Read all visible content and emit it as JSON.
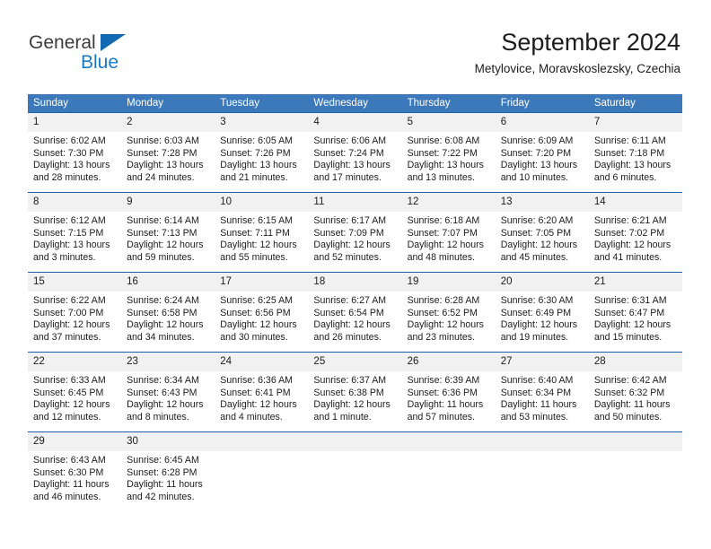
{
  "brand": {
    "name_top": "General",
    "name_bottom": "Blue",
    "triangle_color": "#1268b3",
    "top_color": "#3c3c3c",
    "bottom_color": "#1a7ac4"
  },
  "header": {
    "title": "September 2024",
    "subtitle": "Metylovice, Moravskoslezsky, Czechia"
  },
  "theme": {
    "header_bg": "#3b79ba",
    "week_border": "#1c5ea8",
    "daynum_bg": "#f1f1f1",
    "text": "#1c1c1c"
  },
  "weekdays": [
    "Sunday",
    "Monday",
    "Tuesday",
    "Wednesday",
    "Thursday",
    "Friday",
    "Saturday"
  ],
  "weeks": [
    [
      {
        "day": "1",
        "sunrise": "Sunrise: 6:02 AM",
        "sunset": "Sunset: 7:30 PM",
        "daylight1": "Daylight: 13 hours",
        "daylight2": "and 28 minutes."
      },
      {
        "day": "2",
        "sunrise": "Sunrise: 6:03 AM",
        "sunset": "Sunset: 7:28 PM",
        "daylight1": "Daylight: 13 hours",
        "daylight2": "and 24 minutes."
      },
      {
        "day": "3",
        "sunrise": "Sunrise: 6:05 AM",
        "sunset": "Sunset: 7:26 PM",
        "daylight1": "Daylight: 13 hours",
        "daylight2": "and 21 minutes."
      },
      {
        "day": "4",
        "sunrise": "Sunrise: 6:06 AM",
        "sunset": "Sunset: 7:24 PM",
        "daylight1": "Daylight: 13 hours",
        "daylight2": "and 17 minutes."
      },
      {
        "day": "5",
        "sunrise": "Sunrise: 6:08 AM",
        "sunset": "Sunset: 7:22 PM",
        "daylight1": "Daylight: 13 hours",
        "daylight2": "and 13 minutes."
      },
      {
        "day": "6",
        "sunrise": "Sunrise: 6:09 AM",
        "sunset": "Sunset: 7:20 PM",
        "daylight1": "Daylight: 13 hours",
        "daylight2": "and 10 minutes."
      },
      {
        "day": "7",
        "sunrise": "Sunrise: 6:11 AM",
        "sunset": "Sunset: 7:18 PM",
        "daylight1": "Daylight: 13 hours",
        "daylight2": "and 6 minutes."
      }
    ],
    [
      {
        "day": "8",
        "sunrise": "Sunrise: 6:12 AM",
        "sunset": "Sunset: 7:15 PM",
        "daylight1": "Daylight: 13 hours",
        "daylight2": "and 3 minutes."
      },
      {
        "day": "9",
        "sunrise": "Sunrise: 6:14 AM",
        "sunset": "Sunset: 7:13 PM",
        "daylight1": "Daylight: 12 hours",
        "daylight2": "and 59 minutes."
      },
      {
        "day": "10",
        "sunrise": "Sunrise: 6:15 AM",
        "sunset": "Sunset: 7:11 PM",
        "daylight1": "Daylight: 12 hours",
        "daylight2": "and 55 minutes."
      },
      {
        "day": "11",
        "sunrise": "Sunrise: 6:17 AM",
        "sunset": "Sunset: 7:09 PM",
        "daylight1": "Daylight: 12 hours",
        "daylight2": "and 52 minutes."
      },
      {
        "day": "12",
        "sunrise": "Sunrise: 6:18 AM",
        "sunset": "Sunset: 7:07 PM",
        "daylight1": "Daylight: 12 hours",
        "daylight2": "and 48 minutes."
      },
      {
        "day": "13",
        "sunrise": "Sunrise: 6:20 AM",
        "sunset": "Sunset: 7:05 PM",
        "daylight1": "Daylight: 12 hours",
        "daylight2": "and 45 minutes."
      },
      {
        "day": "14",
        "sunrise": "Sunrise: 6:21 AM",
        "sunset": "Sunset: 7:02 PM",
        "daylight1": "Daylight: 12 hours",
        "daylight2": "and 41 minutes."
      }
    ],
    [
      {
        "day": "15",
        "sunrise": "Sunrise: 6:22 AM",
        "sunset": "Sunset: 7:00 PM",
        "daylight1": "Daylight: 12 hours",
        "daylight2": "and 37 minutes."
      },
      {
        "day": "16",
        "sunrise": "Sunrise: 6:24 AM",
        "sunset": "Sunset: 6:58 PM",
        "daylight1": "Daylight: 12 hours",
        "daylight2": "and 34 minutes."
      },
      {
        "day": "17",
        "sunrise": "Sunrise: 6:25 AM",
        "sunset": "Sunset: 6:56 PM",
        "daylight1": "Daylight: 12 hours",
        "daylight2": "and 30 minutes."
      },
      {
        "day": "18",
        "sunrise": "Sunrise: 6:27 AM",
        "sunset": "Sunset: 6:54 PM",
        "daylight1": "Daylight: 12 hours",
        "daylight2": "and 26 minutes."
      },
      {
        "day": "19",
        "sunrise": "Sunrise: 6:28 AM",
        "sunset": "Sunset: 6:52 PM",
        "daylight1": "Daylight: 12 hours",
        "daylight2": "and 23 minutes."
      },
      {
        "day": "20",
        "sunrise": "Sunrise: 6:30 AM",
        "sunset": "Sunset: 6:49 PM",
        "daylight1": "Daylight: 12 hours",
        "daylight2": "and 19 minutes."
      },
      {
        "day": "21",
        "sunrise": "Sunrise: 6:31 AM",
        "sunset": "Sunset: 6:47 PM",
        "daylight1": "Daylight: 12 hours",
        "daylight2": "and 15 minutes."
      }
    ],
    [
      {
        "day": "22",
        "sunrise": "Sunrise: 6:33 AM",
        "sunset": "Sunset: 6:45 PM",
        "daylight1": "Daylight: 12 hours",
        "daylight2": "and 12 minutes."
      },
      {
        "day": "23",
        "sunrise": "Sunrise: 6:34 AM",
        "sunset": "Sunset: 6:43 PM",
        "daylight1": "Daylight: 12 hours",
        "daylight2": "and 8 minutes."
      },
      {
        "day": "24",
        "sunrise": "Sunrise: 6:36 AM",
        "sunset": "Sunset: 6:41 PM",
        "daylight1": "Daylight: 12 hours",
        "daylight2": "and 4 minutes."
      },
      {
        "day": "25",
        "sunrise": "Sunrise: 6:37 AM",
        "sunset": "Sunset: 6:38 PM",
        "daylight1": "Daylight: 12 hours",
        "daylight2": "and 1 minute."
      },
      {
        "day": "26",
        "sunrise": "Sunrise: 6:39 AM",
        "sunset": "Sunset: 6:36 PM",
        "daylight1": "Daylight: 11 hours",
        "daylight2": "and 57 minutes."
      },
      {
        "day": "27",
        "sunrise": "Sunrise: 6:40 AM",
        "sunset": "Sunset: 6:34 PM",
        "daylight1": "Daylight: 11 hours",
        "daylight2": "and 53 minutes."
      },
      {
        "day": "28",
        "sunrise": "Sunrise: 6:42 AM",
        "sunset": "Sunset: 6:32 PM",
        "daylight1": "Daylight: 11 hours",
        "daylight2": "and 50 minutes."
      }
    ],
    [
      {
        "day": "29",
        "sunrise": "Sunrise: 6:43 AM",
        "sunset": "Sunset: 6:30 PM",
        "daylight1": "Daylight: 11 hours",
        "daylight2": "and 46 minutes."
      },
      {
        "day": "30",
        "sunrise": "Sunrise: 6:45 AM",
        "sunset": "Sunset: 6:28 PM",
        "daylight1": "Daylight: 11 hours",
        "daylight2": "and 42 minutes."
      },
      {
        "day": "",
        "sunrise": "",
        "sunset": "",
        "daylight1": "",
        "daylight2": ""
      },
      {
        "day": "",
        "sunrise": "",
        "sunset": "",
        "daylight1": "",
        "daylight2": ""
      },
      {
        "day": "",
        "sunrise": "",
        "sunset": "",
        "daylight1": "",
        "daylight2": ""
      },
      {
        "day": "",
        "sunrise": "",
        "sunset": "",
        "daylight1": "",
        "daylight2": ""
      },
      {
        "day": "",
        "sunrise": "",
        "sunset": "",
        "daylight1": "",
        "daylight2": ""
      }
    ]
  ]
}
